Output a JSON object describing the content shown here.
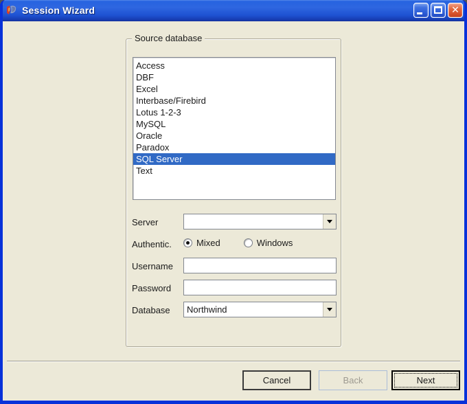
{
  "window": {
    "title": "Session Wizard"
  },
  "titlebar": {
    "buttons": {
      "minimize": "minimize",
      "maximize": "maximize",
      "close": "close"
    }
  },
  "source_group": {
    "label": "Source database",
    "items": [
      "Access",
      "DBF",
      "Excel",
      "Interbase/Firebird",
      "Lotus 1-2-3",
      "MySQL",
      "Oracle",
      "Paradox",
      "SQL Server",
      "Text"
    ],
    "selected_item": "SQL Server",
    "selected_index": 8
  },
  "form": {
    "server": {
      "label": "Server",
      "value": ""
    },
    "authentication": {
      "label": "Authentic.",
      "options": [
        {
          "label": "Mixed",
          "selected": true
        },
        {
          "label": "Windows",
          "selected": false
        }
      ]
    },
    "username": {
      "label": "Username",
      "value": ""
    },
    "password": {
      "label": "Password",
      "value": ""
    },
    "database": {
      "label": "Database",
      "value": "Northwind"
    }
  },
  "footer": {
    "cancel": "Cancel",
    "back": "Back",
    "next": "Next"
  },
  "colors": {
    "titlebar_blue": "#2E66E0",
    "window_border": "#0831D9",
    "client_bg": "#ECE9D8",
    "selection_blue": "#316AC5",
    "close_red": "#D7512A"
  }
}
